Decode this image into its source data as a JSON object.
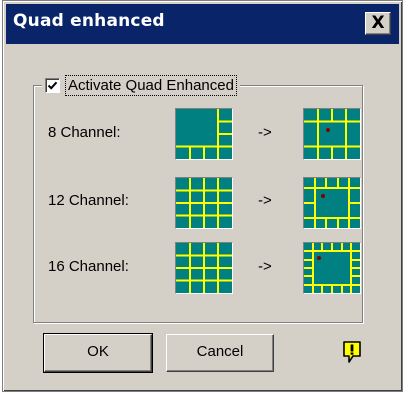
{
  "window": {
    "title": "Quad enhanced",
    "close_label": "X"
  },
  "group": {
    "checkbox_checked": true,
    "checkbox_label": "Activate Quad Enhanced"
  },
  "rows": [
    {
      "label": "8 Channel:",
      "arrow": "->"
    },
    {
      "label": "12 Channel:",
      "arrow": "->"
    },
    {
      "label": "16 Channel:",
      "arrow": "->"
    }
  ],
  "buttons": {
    "ok_label": "OK",
    "cancel_label": "Cancel"
  },
  "icons": {
    "close": "close-x-icon",
    "check": "check-icon",
    "warning": "exclamation-icon",
    "layout": "grid-layout-icon"
  },
  "colors": {
    "titlebar": "#0a246a",
    "dialog_bg": "#d4d0c8",
    "layout_fill": "#008080",
    "grid_lines": "#ffff00",
    "marker": "#800000",
    "warning_fill": "#ffff00"
  }
}
